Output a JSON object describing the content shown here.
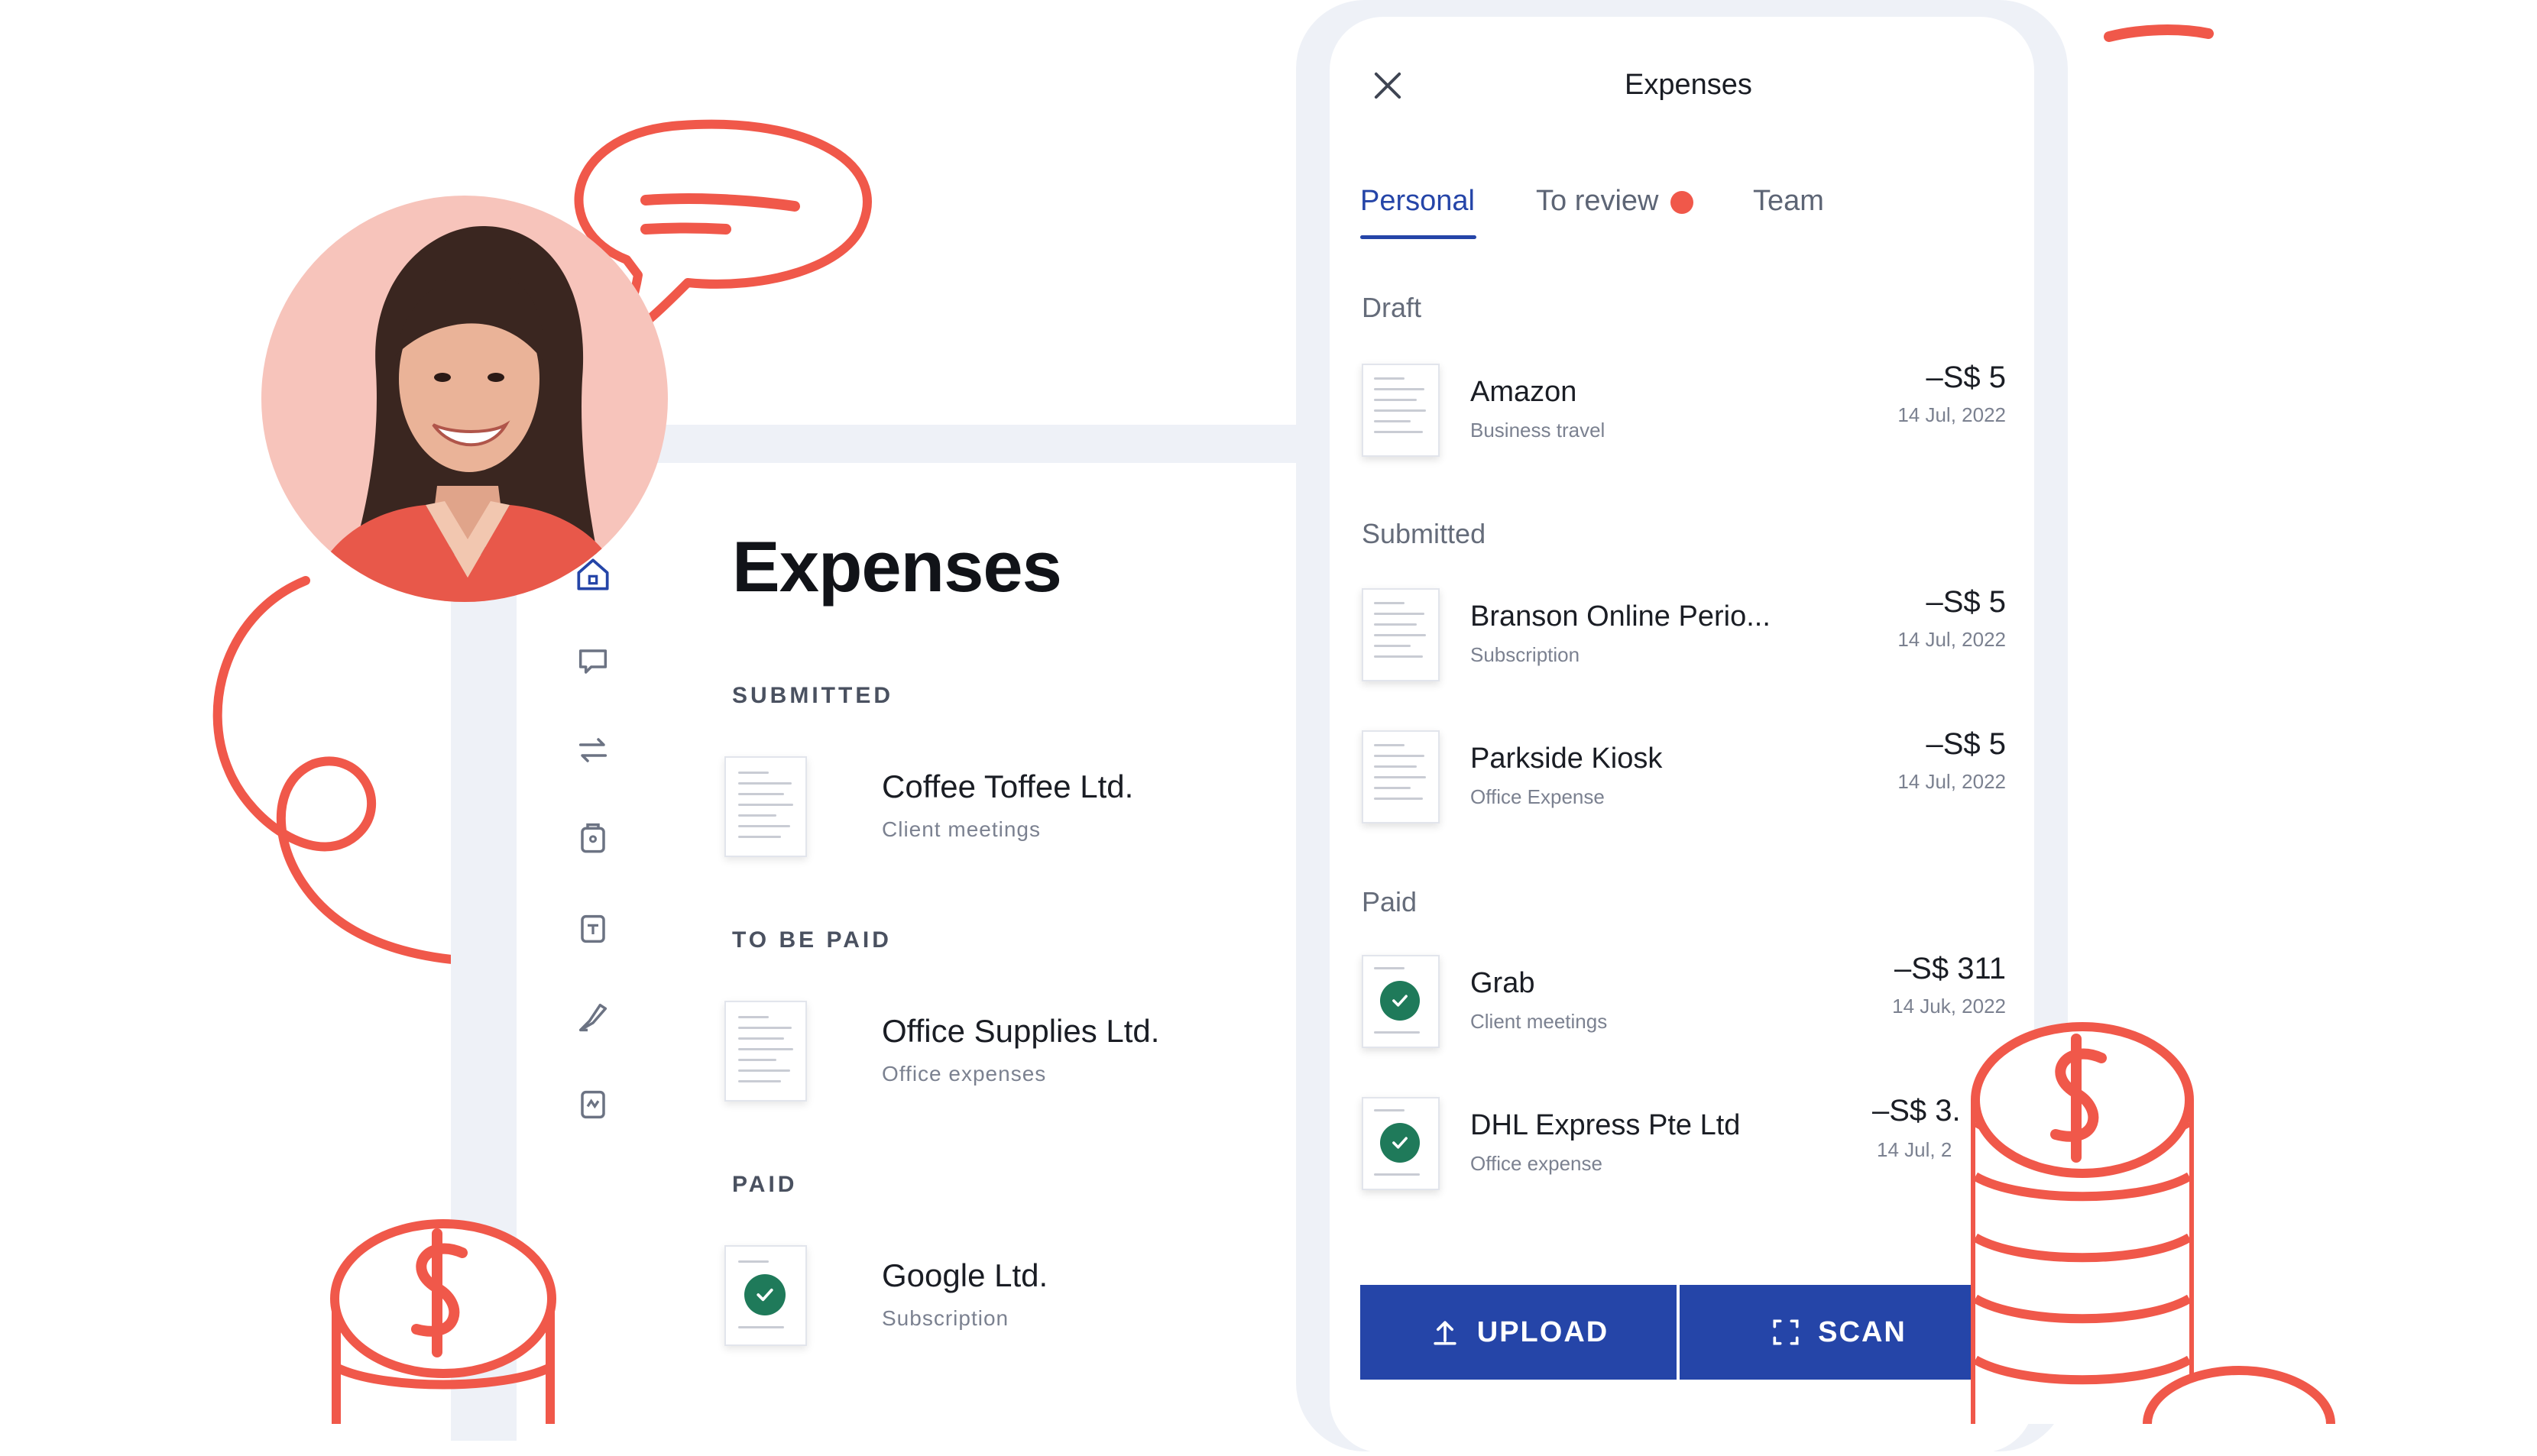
{
  "desktop": {
    "title": "Expenses",
    "sections": [
      {
        "label": "SUBMITTED",
        "items": [
          {
            "name": "Coffee Toffee Ltd.",
            "category": "Client meetings",
            "paid": false
          }
        ]
      },
      {
        "label": "TO BE PAID",
        "items": [
          {
            "name": "Office Supplies Ltd.",
            "category": "Office expenses",
            "paid": false
          }
        ]
      },
      {
        "label": "PAID",
        "items": [
          {
            "name": "Google Ltd.",
            "category": "Subscription",
            "paid": true
          }
        ]
      }
    ],
    "nav_icons": [
      "home-icon",
      "chat-icon",
      "transfer-icon",
      "wallet-icon",
      "card-icon",
      "plane-icon",
      "chart-icon"
    ]
  },
  "phone": {
    "title": "Expenses",
    "tabs": [
      {
        "label": "Personal",
        "active": true
      },
      {
        "label": "To review",
        "active": false,
        "has_dot": true
      },
      {
        "label": "Team",
        "active": false
      }
    ],
    "sections": [
      {
        "label": "Draft",
        "items": [
          {
            "name": "Amazon",
            "category": "Business travel",
            "amount": "–S$ 5",
            "date": "14 Jul, 2022",
            "paid": false
          }
        ]
      },
      {
        "label": "Submitted",
        "items": [
          {
            "name": "Branson Online Perio...",
            "category": "Subscription",
            "amount": "–S$ 5",
            "date": "14 Jul, 2022",
            "paid": false
          },
          {
            "name": "Parkside Kiosk",
            "category": "Office Expense",
            "amount": "–S$ 5",
            "date": "14 Jul, 2022",
            "paid": false
          }
        ]
      },
      {
        "label": "Paid",
        "items": [
          {
            "name": "Grab",
            "category": "Client meetings",
            "amount": "–S$ 311",
            "date": "14 Juk, 2022",
            "paid": true
          },
          {
            "name": "DHL Express Pte Ltd",
            "category": "Office expense",
            "amount": "–S$ 3.",
            "date": "14 Jul, 2",
            "paid": true
          }
        ]
      }
    ],
    "buttons": {
      "upload": "UPLOAD",
      "scan": "SCAN"
    }
  },
  "colors": {
    "accent": "#2545a8",
    "doodle": "#f0584a",
    "paid_check": "#1f7a5a",
    "avatar_bg": "#f7c4bb",
    "frame": "#eef1f7"
  }
}
